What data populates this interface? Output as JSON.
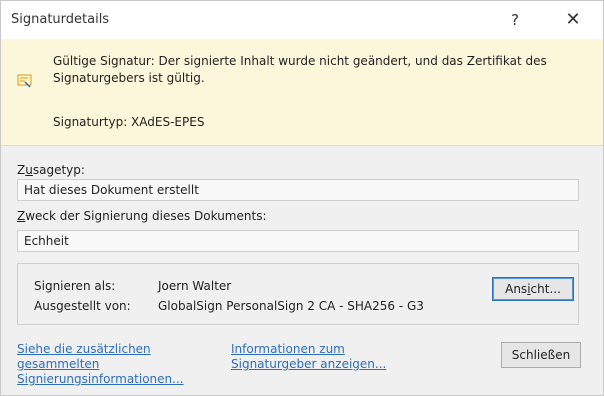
{
  "window": {
    "title": "Signaturdetails",
    "help_label": "?",
    "close_label": "✕"
  },
  "banner": {
    "message": "Gültige Signatur: Der signierte Inhalt wurde nicht geändert, und das Zertifikat des Signaturgebers ist gültig.",
    "signature_type": "Signaturtyp: XAdES-EPES",
    "icon": "signature-certificate-icon"
  },
  "commitment": {
    "label_first": "Z",
    "label_u": "u",
    "label_rest": "sagetyp:",
    "value": "Hat dieses Dokument erstellt"
  },
  "purpose": {
    "label_u": "Z",
    "label_rest": "weck der Signierung dieses Dokuments:",
    "value": "Echheit"
  },
  "signer": {
    "signed_as_label": "Signieren als:",
    "signed_as_value": "Joern Walter",
    "issued_by_label": "Ausgestellt von:",
    "issued_by_value": "GlobalSign PersonalSign 2 CA - SHA256 - G3"
  },
  "buttons": {
    "view_pre": "Ans",
    "view_u": "i",
    "view_post": "cht...",
    "close": "Schließen"
  },
  "links": {
    "additional_info": [
      "Siehe die zusätzlichen",
      "gesammelten",
      "Signierungsinformationen..."
    ],
    "signer_info": [
      "Informationen zum",
      "Signaturgeber anzeigen..."
    ]
  },
  "colors": {
    "banner_bg": "#fcf7da",
    "link": "#2d6eb8",
    "primary_border": "#2a72c4"
  }
}
